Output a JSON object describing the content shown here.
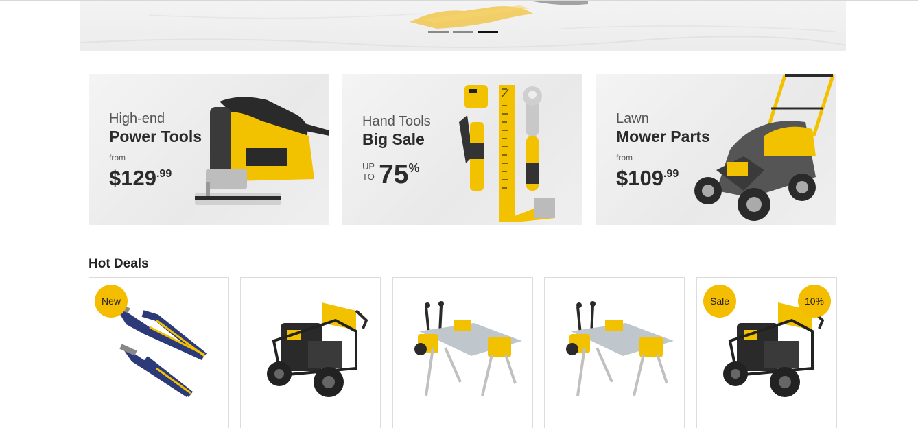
{
  "hero": {
    "slide_count": 3,
    "active_slide": 3
  },
  "promos": [
    {
      "eyebrow": "High-end",
      "headline": "Power Tools",
      "from": "from",
      "price_main": "$129",
      "price_cents": ".99",
      "image": "jigsaw-image"
    },
    {
      "eyebrow": "Hand Tools",
      "headline": "Big Sale",
      "up": "UP",
      "to": "TO",
      "percent": "75",
      "percent_sign": "%",
      "image": "hand-tools-image"
    },
    {
      "eyebrow": "Lawn",
      "headline": "Mower Parts",
      "from": "from",
      "price_main": "$109",
      "price_cents": ".99",
      "image": "lawn-mower-image"
    }
  ],
  "hot_deals": {
    "title": "Hot Deals",
    "products": [
      {
        "image": "pliers-image",
        "badges": [
          "New"
        ]
      },
      {
        "image": "pressure-washer-image",
        "badges": []
      },
      {
        "image": "miter-saw-stand-image",
        "badges": []
      },
      {
        "image": "miter-saw-stand-image",
        "badges": []
      },
      {
        "image": "pressure-washer-image",
        "badges": [
          "Sale",
          "10%"
        ]
      }
    ]
  },
  "colors": {
    "accent": "#f5bd00",
    "tool_yellow": "#f2c200",
    "text_dark": "#2b2b2b",
    "dot_active": "#111111",
    "dot_inactive": "#8a8a8a"
  }
}
